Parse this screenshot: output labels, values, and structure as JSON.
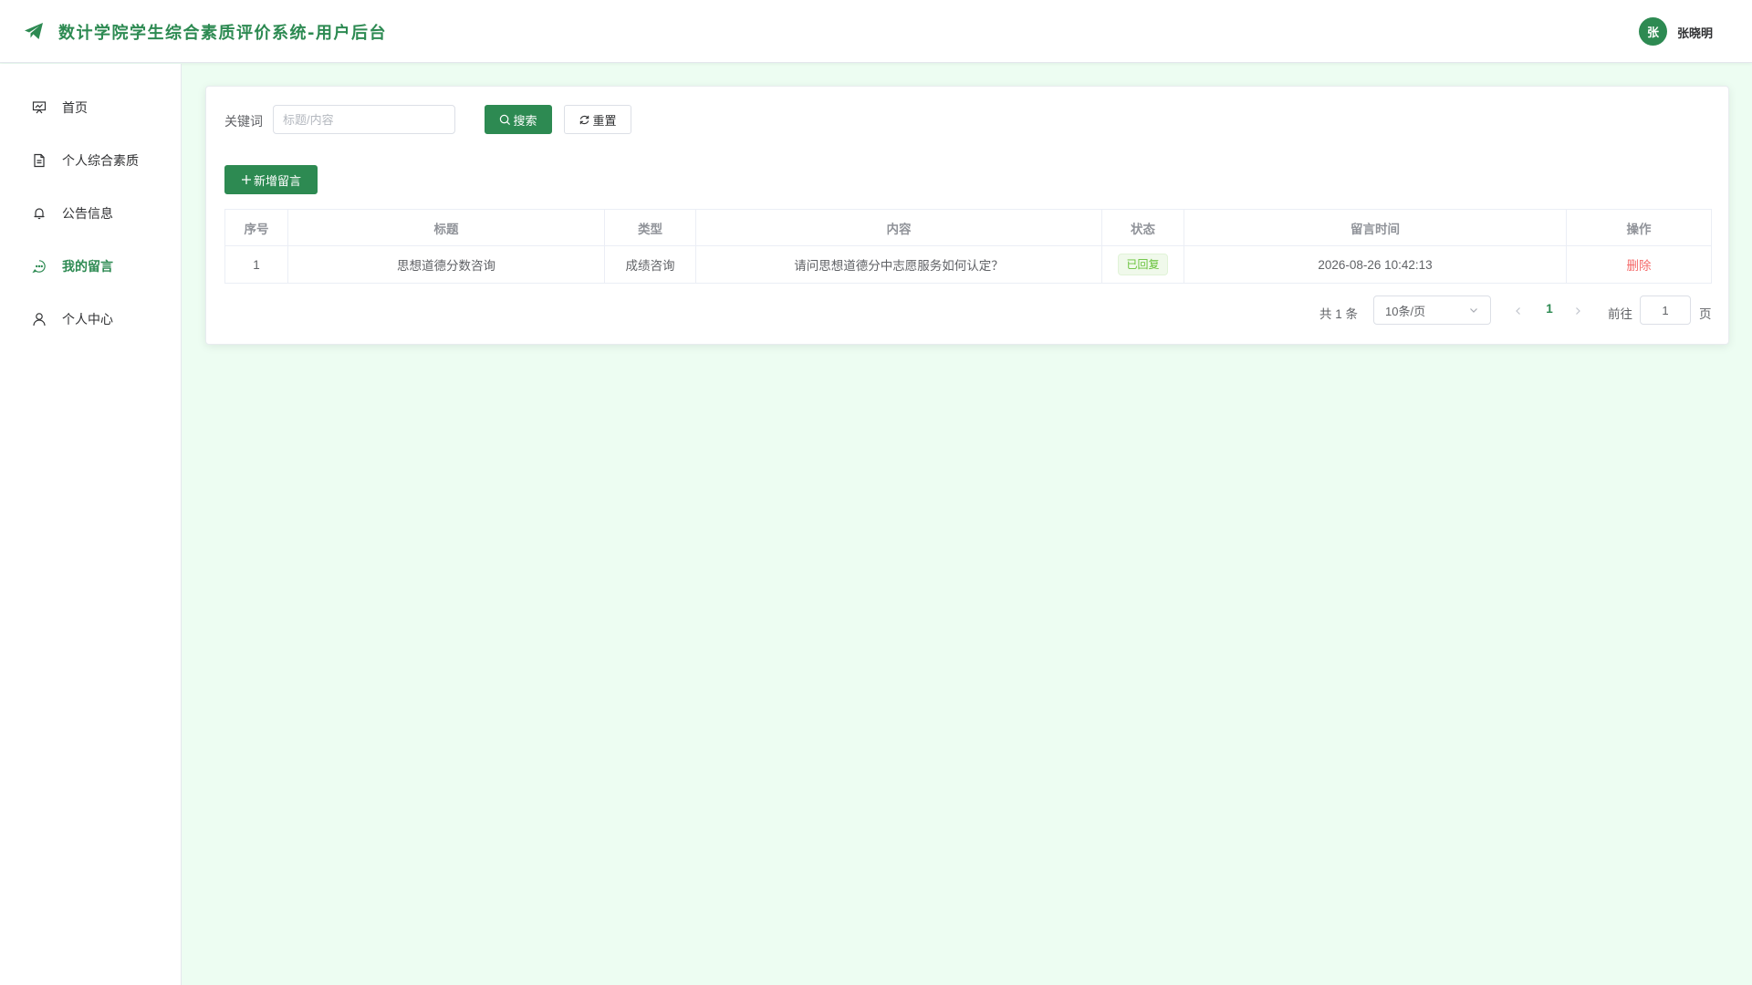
{
  "header": {
    "title": "数计学院学生综合素质评价系统-用户后台",
    "avatar_text": "张",
    "user_name": "张晓明"
  },
  "sidebar": {
    "items": [
      {
        "label": "首页",
        "icon": "presentation-icon",
        "active": false
      },
      {
        "label": "个人综合素质",
        "icon": "document-icon",
        "active": false
      },
      {
        "label": "公告信息",
        "icon": "bell-icon",
        "active": false
      },
      {
        "label": "我的留言",
        "icon": "chat-icon",
        "active": true
      },
      {
        "label": "个人中心",
        "icon": "user-icon",
        "active": false
      }
    ]
  },
  "search": {
    "label": "关键词",
    "placeholder": "标题/内容",
    "value": "",
    "search_label": "搜索",
    "reset_label": "重置"
  },
  "toolbar": {
    "add_label": "新增留言"
  },
  "table": {
    "columns": [
      "序号",
      "标题",
      "类型",
      "内容",
      "状态",
      "留言时间",
      "操作"
    ],
    "rows": [
      {
        "index": "1",
        "title": "思想道德分数咨询",
        "type": "成绩咨询",
        "content": "请问思想道德分中志愿服务如何认定？",
        "status": "已回复",
        "time": "2026-08-26 10:42:13",
        "action": "删除"
      }
    ]
  },
  "pagination": {
    "total_text": "共 1 条",
    "page_size": "10条/页",
    "current_page": "1",
    "goto_label": "前往",
    "goto_value": "1",
    "page_suffix": "页"
  },
  "colors": {
    "primary": "#2d8a52",
    "background": "#edfdf2",
    "danger": "#f56c6c",
    "success": "#67c23a"
  }
}
